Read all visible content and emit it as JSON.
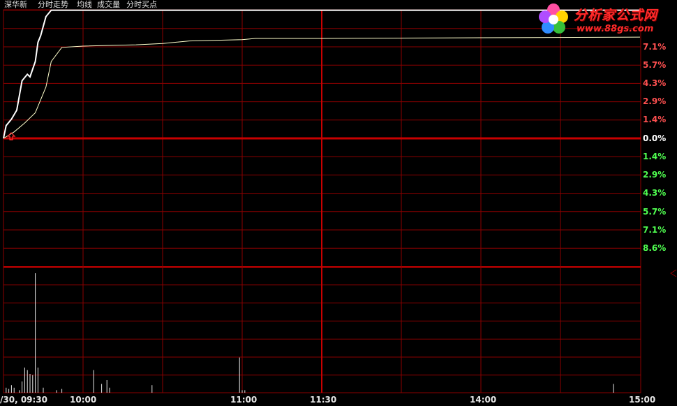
{
  "header": {
    "stock_name": "深华新",
    "menu": [
      "分时走势",
      "均线",
      "成交量",
      "分时买点"
    ]
  },
  "watermark": {
    "site_name": "分析家公式网",
    "url": "www.88gs.com"
  },
  "colors": {
    "grid": "#8b0000",
    "zero_line": "#c80000",
    "price_line": "#ffffff",
    "avg_line": "#ffffcc",
    "up_text": "#ff5050",
    "down_text": "#50ff50",
    "volume_bar": "#e8e8e8",
    "buy_marker": "#ff3030"
  },
  "icons": {
    "buy_point": "up-arrow-icon"
  },
  "y_axis_labels": {
    "up": [
      "7.1%",
      "5.7%",
      "4.3%",
      "2.9%",
      "1.4%"
    ],
    "zero": "0.0%",
    "down": [
      "1.4%",
      "2.9%",
      "4.3%",
      "5.7%",
      "7.1%",
      "8.6%"
    ]
  },
  "x_axis_labels": [
    "/30, 09:30",
    "10:00",
    "11:00",
    "11:30",
    "14:00",
    "15:00"
  ],
  "chart_data": [
    {
      "type": "line",
      "title": "",
      "xlabel": "",
      "ylabel": "",
      "x_unit": "minutes from 09:30 open",
      "ylim": [
        -10,
        10
      ],
      "series": [
        {
          "key": "price",
          "x": [
            0,
            1,
            3,
            5,
            7,
            9,
            10,
            12,
            13,
            14,
            16,
            18,
            20,
            22,
            240
          ],
          "values": [
            0,
            1.0,
            1.5,
            2.2,
            4.5,
            5.0,
            4.8,
            6.0,
            7.5,
            8.0,
            9.5,
            10.0,
            10.0,
            10.0,
            10.0
          ]
        },
        {
          "key": "average",
          "x": [
            0,
            4,
            8,
            12,
            16,
            18,
            22,
            30,
            50,
            60,
            70,
            90,
            95,
            120,
            180,
            240
          ],
          "values": [
            0,
            0.5,
            1.2,
            2.0,
            4.0,
            6.0,
            7.1,
            7.2,
            7.3,
            7.4,
            7.6,
            7.7,
            7.8,
            7.8,
            7.85,
            7.9
          ]
        }
      ]
    },
    {
      "type": "bar",
      "title": "",
      "xlabel": "",
      "ylabel": "",
      "x_unit": "minutes from 09:30 open",
      "ylim": [
        0,
        100
      ],
      "x": [
        1,
        2,
        3,
        4,
        6,
        7,
        8,
        9,
        10,
        11,
        12,
        13,
        15,
        20,
        22,
        34,
        37,
        39,
        40,
        56,
        89,
        90,
        91,
        230
      ],
      "values": [
        4,
        3,
        6,
        4,
        2,
        9,
        20,
        18,
        15,
        14,
        95,
        20,
        4,
        2,
        3,
        18,
        7,
        10,
        4,
        6,
        28,
        2,
        2,
        7
      ]
    }
  ]
}
